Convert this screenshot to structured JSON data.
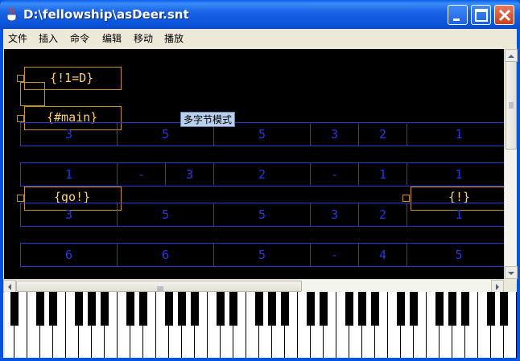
{
  "window": {
    "title": "D:\\fellowship\\asDeer.snt",
    "controls": [
      "minimize",
      "maximize",
      "close"
    ]
  },
  "menu": [
    "文件",
    "插入",
    "命令",
    "编辑",
    "移动",
    "播放"
  ],
  "blocks": [
    {
      "label": "{!1=D}"
    },
    {
      "label": "{#main}"
    },
    {
      "label": "{go!}"
    },
    {
      "label": "{!}"
    }
  ],
  "tooltip": "多字节模式",
  "rows": [
    [
      "3",
      "5",
      "5",
      "3",
      "2",
      "1"
    ],
    [
      "1",
      "-",
      "3",
      "2",
      "-",
      "1",
      "1"
    ],
    [
      "3",
      "5",
      "5",
      "3",
      "2",
      "1"
    ],
    [
      "6",
      "6",
      "5",
      "-",
      "4",
      "5"
    ]
  ],
  "colors": {
    "titlebar": "#0054e3",
    "canvas": "#000000",
    "block_border": "#c8901c",
    "block_text": "#ffd070",
    "note_cell": "#2838e0",
    "tooltip_bg": "#b8d0ec"
  },
  "icons": {
    "app": "java-cup-icon",
    "scroll_up": "arrow-up-icon",
    "scroll_down": "arrow-down-icon",
    "scroll_left": "arrow-left-icon",
    "scroll_right": "arrow-right-icon"
  }
}
